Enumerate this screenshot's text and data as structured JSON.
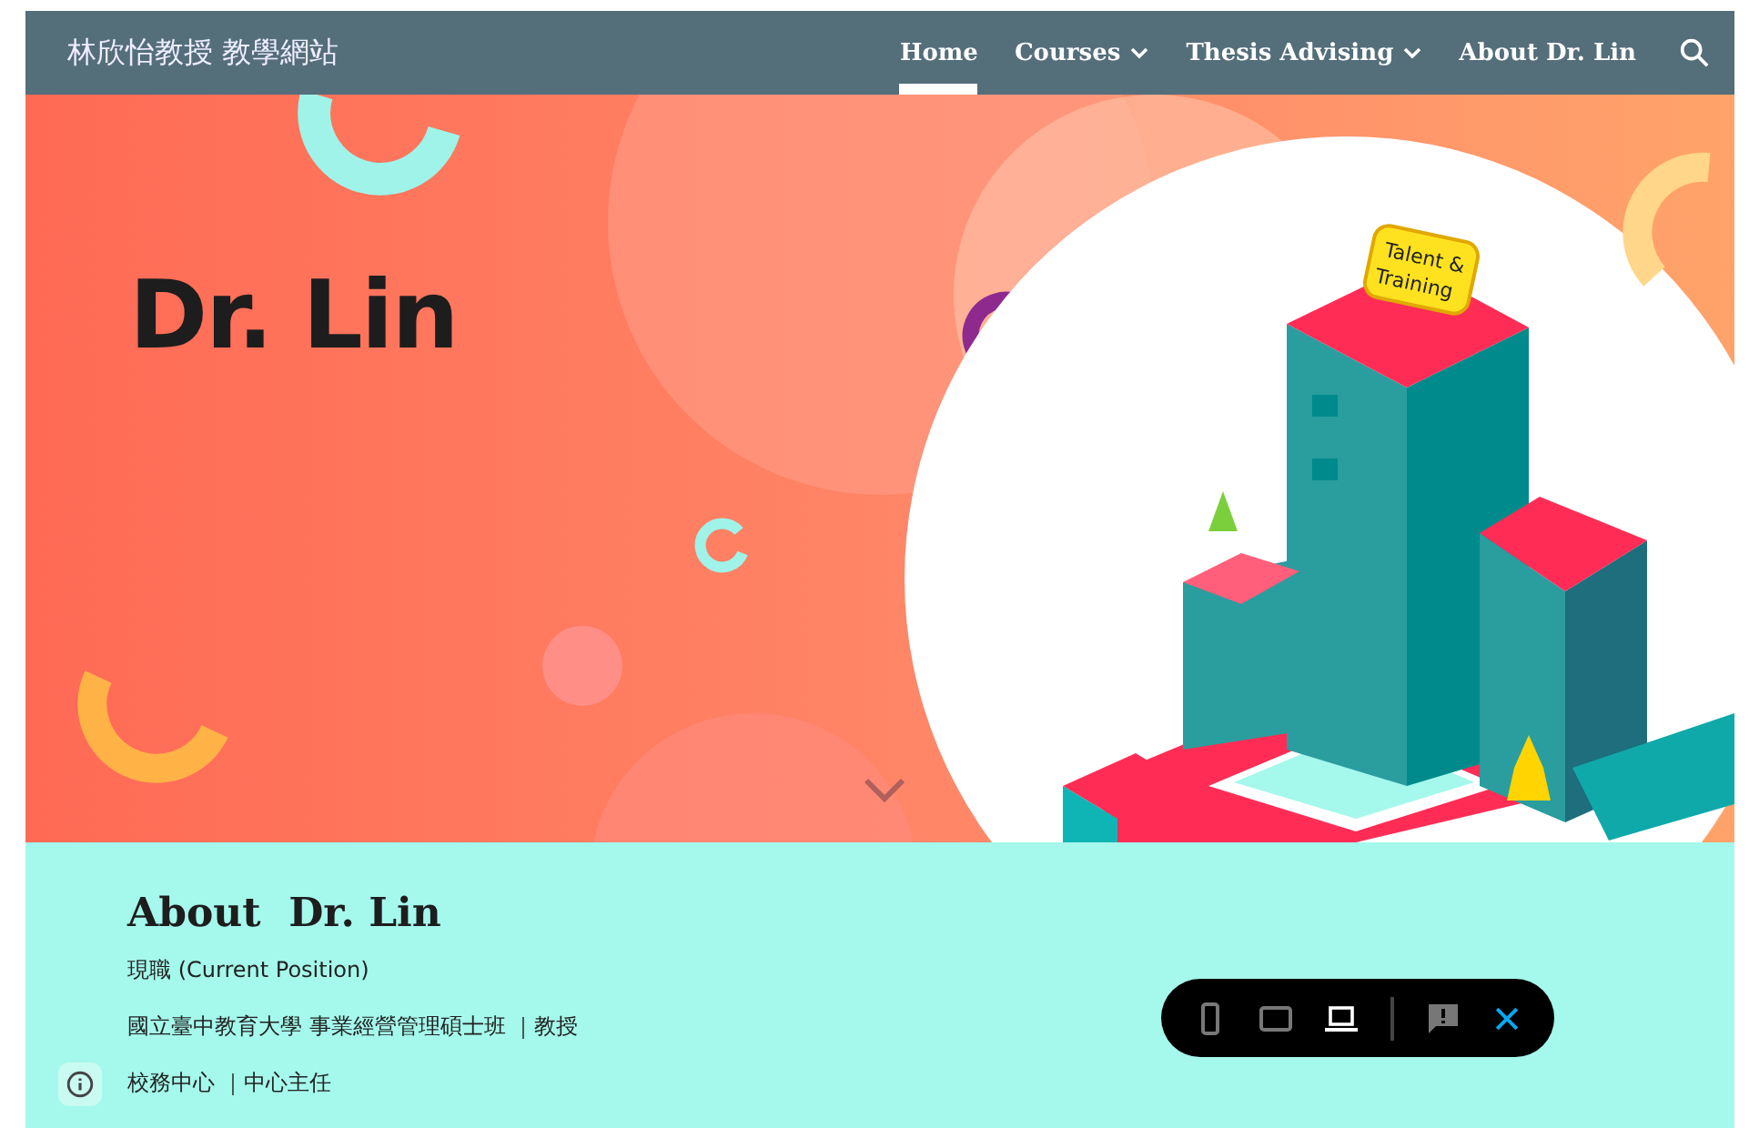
{
  "site_title": "林欣怡教授 教學網站",
  "nav": [
    {
      "label": "Home",
      "selected": true,
      "has_menu": false
    },
    {
      "label": "Courses",
      "selected": false,
      "has_menu": true
    },
    {
      "label": "Thesis Advising",
      "selected": false,
      "has_menu": true
    },
    {
      "label": "About Dr. Lin",
      "selected": false,
      "has_menu": false
    }
  ],
  "hero": {
    "title": "Dr. Lin",
    "sign": [
      "Talent &",
      "Training"
    ]
  },
  "about": {
    "heading": "About  Dr. Lin",
    "lines": [
      "現職 (Current Position)",
      "國立臺中教育大學  事業經營管理碩士班 ｜教授",
      "校務中心 ｜中心主任"
    ]
  },
  "preview_toolbar": {
    "devices": [
      {
        "kind": "phone",
        "selected": false
      },
      {
        "kind": "tablet",
        "selected": false
      },
      {
        "kind": "laptop",
        "selected": true
      }
    ]
  }
}
